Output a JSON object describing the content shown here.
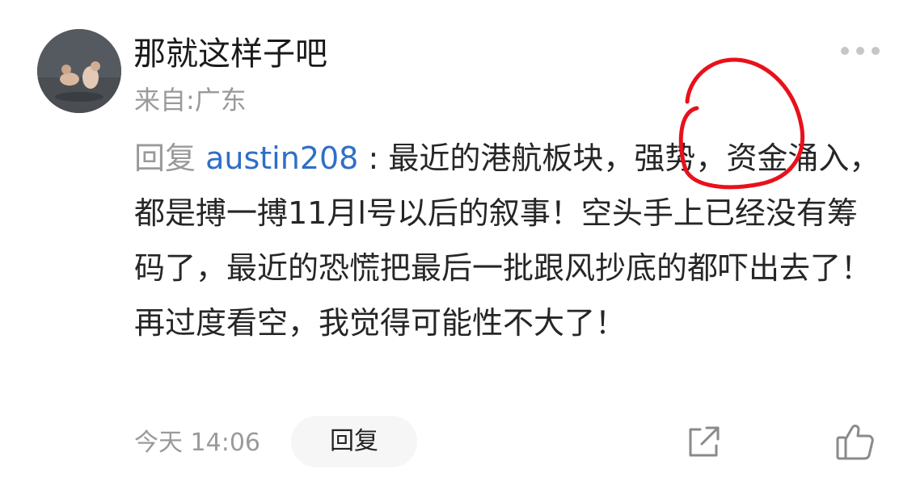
{
  "comment": {
    "username": "那就这样子吧",
    "location": "来自:广东",
    "reply_prefix": "回复",
    "mention": "austin208",
    "separator": " : ",
    "text_part1": "最近的港航板块，",
    "text_highlight": "强势",
    "text_part2": "，资金涌入，都是搏一搏11月l号以后的叙事！空头手上已经没有筹码了，最近的恐慌把最后一批跟风抄底的都吓出去了！再过度看空，我觉得可能性不大了！"
  },
  "footer": {
    "timestamp": "今天 14:06",
    "reply_label": "回复"
  },
  "icons": {
    "more": "more-icon",
    "share": "share-icon",
    "like": "thumbs-up-icon"
  },
  "colors": {
    "mention": "#2f6fc7",
    "annotation": "#e8111b",
    "secondary_text": "#9a9a9a"
  }
}
